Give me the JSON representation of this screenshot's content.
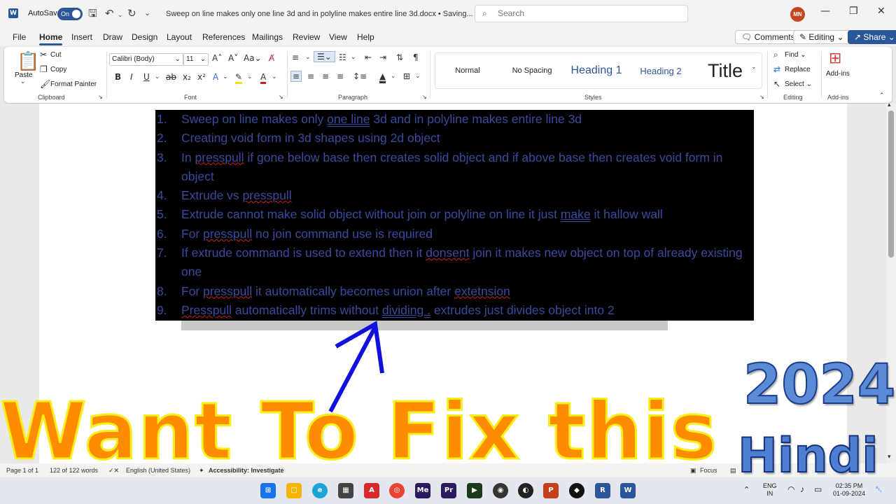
{
  "titlebar": {
    "app_icon_letter": "W",
    "autosave_label": "AutoSave",
    "autosave_state": "On",
    "document_title": "Sweep on line makes only one line 3d and in polyline makes entire line 3d.docx • Saving...",
    "search_placeholder": "Search",
    "user_initials": "MN"
  },
  "tabs": [
    "File",
    "Home",
    "Insert",
    "Draw",
    "Design",
    "Layout",
    "References",
    "Mailings",
    "Review",
    "View",
    "Help"
  ],
  "active_tab": "Home",
  "actions": {
    "comments": "Comments",
    "editing": "Editing",
    "share": "Share"
  },
  "ribbon": {
    "clipboard": {
      "label": "Clipboard",
      "paste": "Paste",
      "cut": "Cut",
      "copy": "Copy",
      "format_painter": "Format Painter"
    },
    "font": {
      "label": "Font",
      "font_name": "Calibri (Body)",
      "font_size": "11"
    },
    "paragraph": {
      "label": "Paragraph"
    },
    "styles": {
      "label": "Styles",
      "items": [
        "Normal",
        "No Spacing",
        "Heading 1",
        "Heading 2",
        "Title"
      ]
    },
    "editing": {
      "label": "Editing",
      "find": "Find",
      "replace": "Replace",
      "select": "Select"
    },
    "addins": {
      "label": "Add-ins",
      "button": "Add-ins"
    }
  },
  "document": {
    "items": [
      {
        "num": "1.",
        "segments": [
          {
            "t": "Sweep on line makes only "
          },
          {
            "t": "one line",
            "s": "dbl"
          },
          {
            "t": " 3d and in polyline makes entire line 3d"
          }
        ]
      },
      {
        "num": "2.",
        "segments": [
          {
            "t": "Creating void form in 3d shapes using 2d object"
          }
        ]
      },
      {
        "num": "3.",
        "segments": [
          {
            "t": "In "
          },
          {
            "t": "presspull",
            "s": "squig"
          },
          {
            "t": " if gone below base then creates solid object and if above base then creates void form in object"
          }
        ]
      },
      {
        "num": "4.",
        "segments": [
          {
            "t": "Extrude vs "
          },
          {
            "t": "presspull",
            "s": "squig"
          }
        ]
      },
      {
        "num": "5.",
        "segments": [
          {
            "t": "Extrude cannot make solid object without join or polyline on line it just "
          },
          {
            "t": "make",
            "s": "dbl"
          },
          {
            "t": " it hallow wall"
          }
        ]
      },
      {
        "num": "6.",
        "segments": [
          {
            "t": "For "
          },
          {
            "t": "presspull",
            "s": "squig"
          },
          {
            "t": " no join command use is required"
          }
        ]
      },
      {
        "num": "7.",
        "segments": [
          {
            "t": "If extrude command is used to extend then it "
          },
          {
            "t": "donsent",
            "s": "squig"
          },
          {
            "t": " join it makes new object on top of already existing one"
          }
        ]
      },
      {
        "num": "8.",
        "segments": [
          {
            "t": "For "
          },
          {
            "t": "presspull",
            "s": "squig"
          },
          {
            "t": " it automatically becomes union after "
          },
          {
            "t": "extetnsion",
            "s": "squig"
          }
        ]
      },
      {
        "num": "9.",
        "segments": [
          {
            "t": "Presspull",
            "s": "squig"
          },
          {
            "t": " automatically trims without "
          },
          {
            "t": "dividing .",
            "s": "dbl"
          },
          {
            "t": " extrudes just divides object into 2"
          }
        ]
      }
    ]
  },
  "statusbar": {
    "page": "Page 1 of 1",
    "words": "122 of 122 words",
    "language": "English (United States)",
    "accessibility": "Accessibility: Investigate",
    "focus": "Focus"
  },
  "taskbar": {
    "lang_top": "ENG",
    "lang_bottom": "IN",
    "time": "02:35 PM",
    "date": "01-09-2024"
  },
  "overlay": {
    "headline": "Want To Fix this",
    "year": "2024",
    "language": "Hindi"
  },
  "colors": {
    "brand": "#2b579a",
    "doc_text": "#3b4a9c",
    "highlight": "#000000",
    "headline": "#ff8c00",
    "headline_stroke": "#f6ef1a",
    "arrow": "#1010e0"
  }
}
